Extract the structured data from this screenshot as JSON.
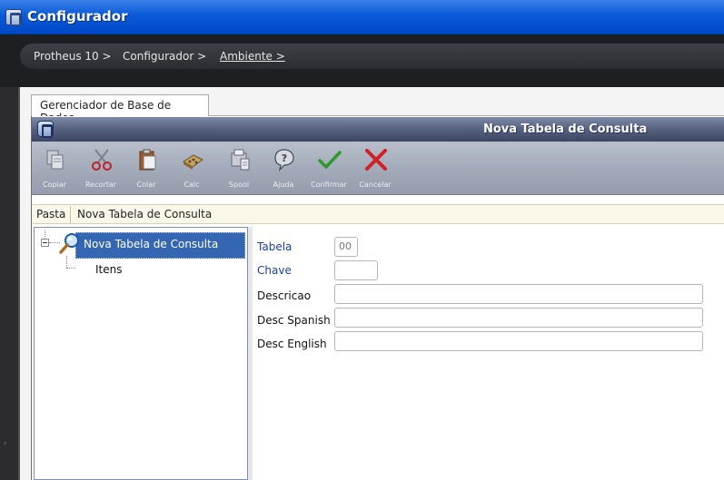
{
  "window": {
    "title": "Configurador"
  },
  "breadcrumbs": [
    {
      "label": "Protheus 10 >"
    },
    {
      "label": "Configurador >"
    },
    {
      "label": "Ambiente >"
    }
  ],
  "tab": {
    "label": "Gerenciador de Base de Dados"
  },
  "dialog": {
    "title": "Nova Tabela de Consulta"
  },
  "toolbar": {
    "buttons": [
      {
        "label": "Copiar",
        "icon": "copy-icon"
      },
      {
        "label": "Recortar",
        "icon": "scissors-icon"
      },
      {
        "label": "Colar",
        "icon": "paste-icon"
      },
      {
        "label": "Calc",
        "icon": "calculator-icon"
      },
      {
        "label": "Spool",
        "icon": "spool-icon"
      },
      {
        "label": "Ajuda",
        "icon": "help-icon"
      },
      {
        "label": "Confirmar",
        "icon": "check-icon"
      },
      {
        "label": "Cancelar",
        "icon": "cancel-icon"
      }
    ]
  },
  "pasta": {
    "label": "Pasta",
    "value": "Nova Tabela de Consulta"
  },
  "tree": {
    "root": {
      "label": "Nova Tabela de Consulta",
      "icon": "search-icon"
    },
    "children": [
      {
        "label": "Itens"
      }
    ]
  },
  "form": {
    "fields": [
      {
        "label": "Tabela",
        "value": "00"
      },
      {
        "label": "Chave",
        "value": ""
      },
      {
        "label": "Descricao",
        "value": ""
      },
      {
        "label": "Desc Spanish",
        "value": ""
      },
      {
        "label": "Desc English",
        "value": ""
      }
    ]
  },
  "colors": {
    "titlebar": "#0a5ad8",
    "selection": "#3566b2",
    "required_label": "#1c3fae"
  }
}
